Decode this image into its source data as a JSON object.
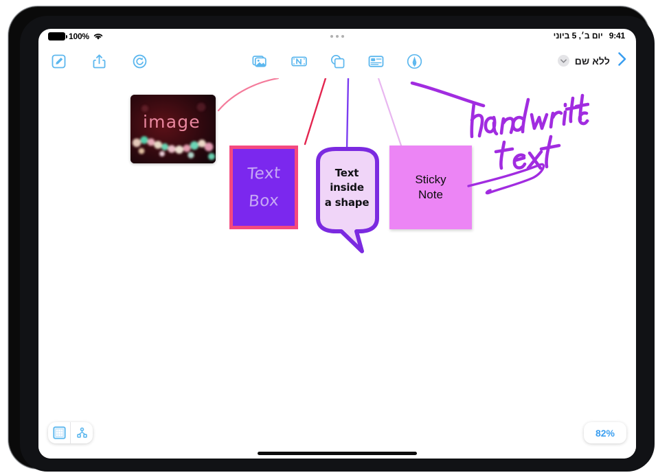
{
  "device": {
    "name": "ipad-frame"
  },
  "statusbar": {
    "battery_percent": "100%",
    "battery_icon": "battery-full-icon",
    "wifi_icon": "wifi-icon",
    "time": "9:41",
    "date": "יום ב׳, 5 ביוני",
    "multitask_handle_icon": "multitasking-dots-icon"
  },
  "toolbar": {
    "left": [
      {
        "name": "compose-button",
        "icon": "compose-pencil-square-icon"
      },
      {
        "name": "share-button",
        "icon": "share-up-arrow-icon"
      },
      {
        "name": "undo-redo-button",
        "icon": "redo-circular-arrow-icon"
      }
    ],
    "center": [
      {
        "name": "insert-media-button",
        "icon": "photos-stack-icon"
      },
      {
        "name": "insert-text-box-button",
        "icon": "text-box-icon"
      },
      {
        "name": "insert-shape-button",
        "icon": "shapes-icon"
      },
      {
        "name": "insert-sticky-note-button",
        "icon": "sticky-note-icon"
      },
      {
        "name": "markup-pen-button",
        "icon": "markup-pen-circle-icon"
      }
    ],
    "right": {
      "chevron_icon": "chevron-down-icon",
      "document_title": "ללא שם",
      "next_icon": "chevron-right-icon"
    }
  },
  "canvas": {
    "image_card": {
      "caption": "image",
      "alt": "dark photo with colorful bokeh lights"
    },
    "text_box": {
      "line1": "Text",
      "line2": "Box"
    },
    "shape": {
      "name": "speech-bubble",
      "line1": "Text",
      "line2": "inside",
      "line3": "a shape"
    },
    "sticky_note": {
      "line1": "Sticky",
      "line2": "Note"
    },
    "handwriting": {
      "line1": "handwritten",
      "line2": "text"
    },
    "connectors": [
      {
        "name": "connector-to-image",
        "color": "#f47b9b"
      },
      {
        "name": "connector-to-text-box",
        "color": "#e3254f"
      },
      {
        "name": "connector-to-shape",
        "color": "#7b3df0"
      },
      {
        "name": "connector-to-sticky-note",
        "color": "#e8b6f0"
      },
      {
        "name": "connector-to-handwriting",
        "color": "#a12ce0"
      }
    ]
  },
  "bottom": {
    "page_thumbnails_icon": "page-grid-icon",
    "map_view_icon": "node-map-icon",
    "zoom_level": "82%"
  },
  "colors": {
    "accent_blue": "#3a9ef0",
    "text_box_fill": "#7b28ee",
    "text_box_border": "#f4497f",
    "bubble_fill": "#f0d5f8",
    "bubble_border": "#7b2ae0",
    "sticky_fill": "#ec85f5",
    "handwriting_ink": "#a12ce0"
  }
}
